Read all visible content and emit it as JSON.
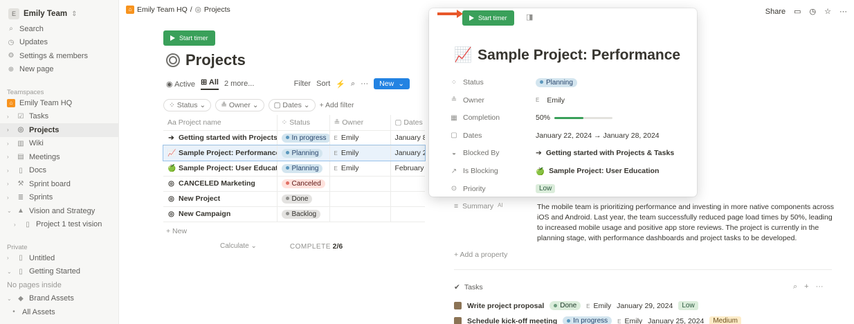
{
  "sidebar": {
    "workspace": {
      "badge": "E",
      "name": "Emily Team",
      "chevron": "⇕"
    },
    "top": [
      {
        "icon": "search-icon",
        "glyph": "⌕",
        "label": "Search"
      },
      {
        "icon": "clock-icon",
        "glyph": "◷",
        "label": "Updates"
      },
      {
        "icon": "gear-icon",
        "glyph": "⚙",
        "label": "Settings & members"
      },
      {
        "icon": "plus-circle-icon",
        "glyph": "⊕",
        "label": "New page"
      }
    ],
    "teamspaces_label": "Teamspaces",
    "teamspace_root": "Emily Team HQ",
    "teamspace_items": [
      {
        "glyph": "☑",
        "label": "Tasks"
      },
      {
        "glyph": "◎",
        "label": "Projects"
      },
      {
        "glyph": "▥",
        "label": "Wiki"
      },
      {
        "glyph": "▤",
        "label": "Meetings"
      },
      {
        "glyph": "▯",
        "label": "Docs"
      },
      {
        "glyph": "⚒",
        "label": "Sprint board"
      },
      {
        "glyph": "≣",
        "label": "Sprints"
      },
      {
        "glyph": "▲",
        "label": "Vision and Strategy"
      },
      {
        "glyph": "▯",
        "label": "Project 1 test vision"
      }
    ],
    "private_label": "Private",
    "private_items": [
      {
        "glyph": "▯",
        "label": "Untitled"
      },
      {
        "glyph": "▯",
        "label": "Getting Started"
      },
      {
        "glyph": "",
        "label": "No pages inside"
      },
      {
        "glyph": "◆",
        "label": "Brand Assets"
      },
      {
        "glyph": "•",
        "label": "All Assets"
      }
    ]
  },
  "breadcrumb": {
    "root": "Emily Team HQ",
    "sep": "/",
    "current": "Projects"
  },
  "timer_label": "Start timer",
  "page_title": "Projects",
  "views": {
    "active_label": "Active",
    "all_label": "All",
    "more_label": "2 more...",
    "filter": "Filter",
    "sort": "Sort",
    "bolt": "⚡",
    "search": "⌕",
    "dots": "···",
    "new_label": "New",
    "new_caret": "⌄"
  },
  "filters": {
    "status": "Status ⌄",
    "owner": "Owner ⌄",
    "dates": "Dates ⌄",
    "add": "+ Add filter"
  },
  "table": {
    "headers": [
      "Aa Project name",
      "Status",
      "Owner",
      "Dates"
    ],
    "rows": [
      {
        "glyph": "➔",
        "name": "Getting started with Projects & Tasks",
        "status": "In progress",
        "owner": "Emily",
        "date": "January 8"
      },
      {
        "glyph": "📈",
        "name": "Sample Project: Performance",
        "status": "Planning",
        "owner": "Emily",
        "date": "January 2"
      },
      {
        "glyph": "🍏",
        "name": "Sample Project: User Education",
        "status": "Planning",
        "owner": "Emily",
        "date": "February"
      },
      {
        "glyph": "◎",
        "name": "CANCELED Marketing",
        "status": "Canceled",
        "owner": "",
        "date": ""
      },
      {
        "glyph": "◎",
        "name": "New Project",
        "status": "Done",
        "owner": "",
        "date": ""
      },
      {
        "glyph": "◎",
        "name": "New Campaign",
        "status": "Backlog",
        "owner": "",
        "date": ""
      }
    ],
    "owner_badge": "E",
    "add_new": "+ New",
    "calculate": "Calculate ⌄",
    "complete_label": "COMPLETE",
    "complete_value": "2/6"
  },
  "top_actions": {
    "share": "Share",
    "comment": "▭",
    "history": "◷",
    "star": "☆",
    "more": "···"
  },
  "panel": {
    "title": "Sample Project: Performance",
    "title_glyph": "📈",
    "layout_glyph": "◨",
    "props": [
      {
        "glyph": "⁘",
        "label": "Status",
        "value": "Planning"
      },
      {
        "glyph": "≗",
        "label": "Owner",
        "value": "Emily"
      },
      {
        "glyph": "▦",
        "label": "Completion",
        "value": "50%"
      },
      {
        "glyph": "▢",
        "label": "Dates",
        "value": "January 22, 2024 → January 28, 2024"
      },
      {
        "glyph": "◒",
        "label": "Blocked By",
        "value": "Getting started with Projects & Tasks"
      },
      {
        "glyph": "↗",
        "label": "Is Blocking",
        "value": "Sample Project: User Education"
      },
      {
        "glyph": "⊙",
        "label": "Priority",
        "value": "Low"
      }
    ],
    "completion_fraction": 0.5
  },
  "summary": {
    "label": "Summary",
    "ai": "AI",
    "text": "The mobile team is prioritizing performance and investing in more native components across iOS and Android. Last year, the team successfully reduced page load times by 50%, leading to increased mobile usage and positive app store reviews. The project is currently in the planning stage, with performance dashboards and project tasks to be developed."
  },
  "add_property": "+ Add a property",
  "tasks": {
    "label": "Tasks",
    "tools": [
      "⌕",
      "+",
      "···"
    ],
    "items": [
      {
        "name": "Write project proposal",
        "status": "Done",
        "owner": "Emily",
        "date": "January 29, 2024",
        "priority": "Low"
      },
      {
        "name": "Schedule kick-off meeting",
        "status": "In progress",
        "owner": "Emily",
        "date": "January 25, 2024",
        "priority": "Medium"
      }
    ]
  },
  "colors": {
    "in_progress_bg": "#d3e5ef",
    "in_progress_fg": "#28456c",
    "in_progress_dot": "#5b97bd",
    "planning_bg": "#d3e5ef",
    "planning_fg": "#28456c",
    "planning_dot": "#5b97bd",
    "canceled_bg": "#ffe2dd",
    "canceled_fg": "#5d1715",
    "canceled_dot": "#e16f64",
    "done_bg": "#e3e2e0",
    "done_fg": "#32302c",
    "done_dot": "#91918e",
    "backlog_bg": "#e3e2e0",
    "backlog_fg": "#32302c",
    "backlog_dot": "#91918e",
    "task_done_bg": "#dbeddb",
    "task_done_fg": "#1c3829",
    "task_done_dot": "#6c9b7d"
  }
}
